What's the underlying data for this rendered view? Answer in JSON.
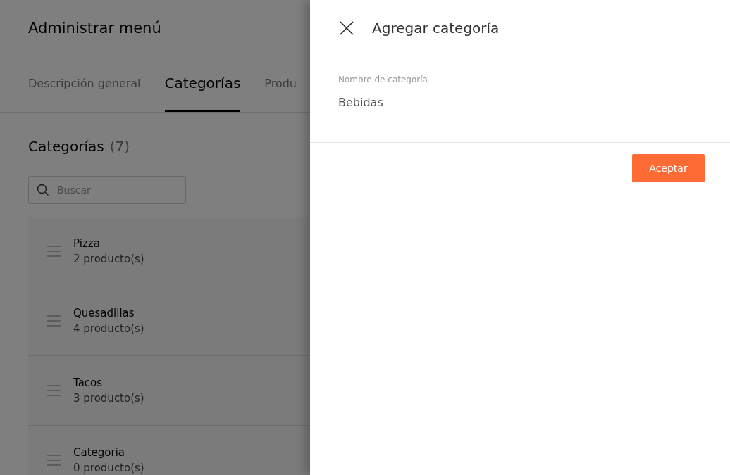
{
  "page": {
    "title": "Administrar menú"
  },
  "tabs": [
    {
      "label": "Descripción general",
      "selected": false
    },
    {
      "label": "Categorías",
      "selected": true
    },
    {
      "label": "Produ",
      "selected": false
    }
  ],
  "section": {
    "title": "Categorías",
    "count": "(7)"
  },
  "search": {
    "placeholder": "Buscar"
  },
  "categories": [
    {
      "name": "Pizza",
      "products": "2 producto(s)"
    },
    {
      "name": "Quesadillas",
      "products": "4 producto(s)"
    },
    {
      "name": "Tacos",
      "products": "3 producto(s)"
    },
    {
      "name": "Categoria",
      "products": "0 producto(s)"
    }
  ],
  "drawer": {
    "title": "Agregar categoría",
    "field": {
      "label": "Nombre de categoría",
      "value": "Bebidas"
    },
    "button": "Aceptar"
  }
}
